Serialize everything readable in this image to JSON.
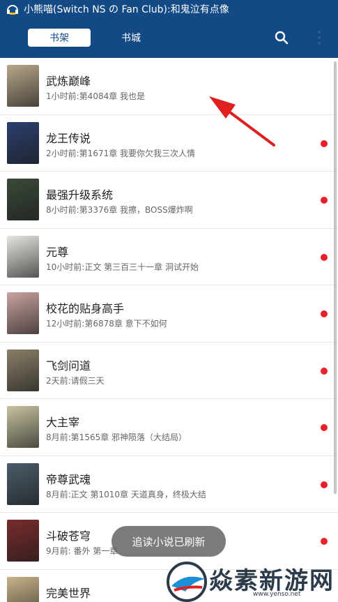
{
  "status_bar": {
    "notification_text": "小熊喵(Switch NS の Fan Club):和鬼泣有点像"
  },
  "app_bar": {
    "tabs": [
      {
        "label": "书架",
        "active": true
      },
      {
        "label": "书城",
        "active": false
      }
    ],
    "search_icon": "search-icon",
    "more_icon": "more-vert-icon"
  },
  "books": [
    {
      "title": "武炼巅峰",
      "meta": "1小时前:第4084章 我也是",
      "unread": false,
      "cover_color": "#b8a78a"
    },
    {
      "title": "龙王传说",
      "meta": "2小时前:第1671章 我要你欠我三次人情",
      "unread": true,
      "cover_color": "#2b3f6e"
    },
    {
      "title": "最强升级系统",
      "meta": "8小时前:第3376章 我擦，BOSS爆炸啊",
      "unread": true,
      "cover_color": "#3a4a3a"
    },
    {
      "title": "元尊",
      "meta": "10小时前:正文 第三百三十一章 洞试开始",
      "unread": true,
      "cover_color": "#e6e6e0"
    },
    {
      "title": "校花的贴身高手",
      "meta": "12小时前:第6878章 意下不如何",
      "unread": true,
      "cover_color": "#c9a3a0"
    },
    {
      "title": "飞剑问道",
      "meta": "2天前:请假三天",
      "unread": true,
      "cover_color": "#8a7f68"
    },
    {
      "title": "大主宰",
      "meta": "8月前:第1565章 邪神陨落（大结局）",
      "unread": true,
      "cover_color": "#c7c2a0"
    },
    {
      "title": "帝尊武魂",
      "meta": "8月前:正文 第1010章 天道真身，终极大结",
      "unread": true,
      "cover_color": "#4a5d6a"
    },
    {
      "title": "斗破苍穹",
      "meta": "9月前: 番外 第一章",
      "unread": true,
      "cover_color": "#7a2c2c"
    },
    {
      "title": "完美世界",
      "meta": "",
      "unread": false,
      "cover_color": "#c9b48a"
    }
  ],
  "toast": {
    "text": "追读小说已刷新"
  },
  "watermark": {
    "text": "焱素新游网",
    "url": "www.yenso.net"
  },
  "colors": {
    "primary": "#134a85",
    "unread_dot": "#e8202a",
    "arrow": "#e02020"
  }
}
